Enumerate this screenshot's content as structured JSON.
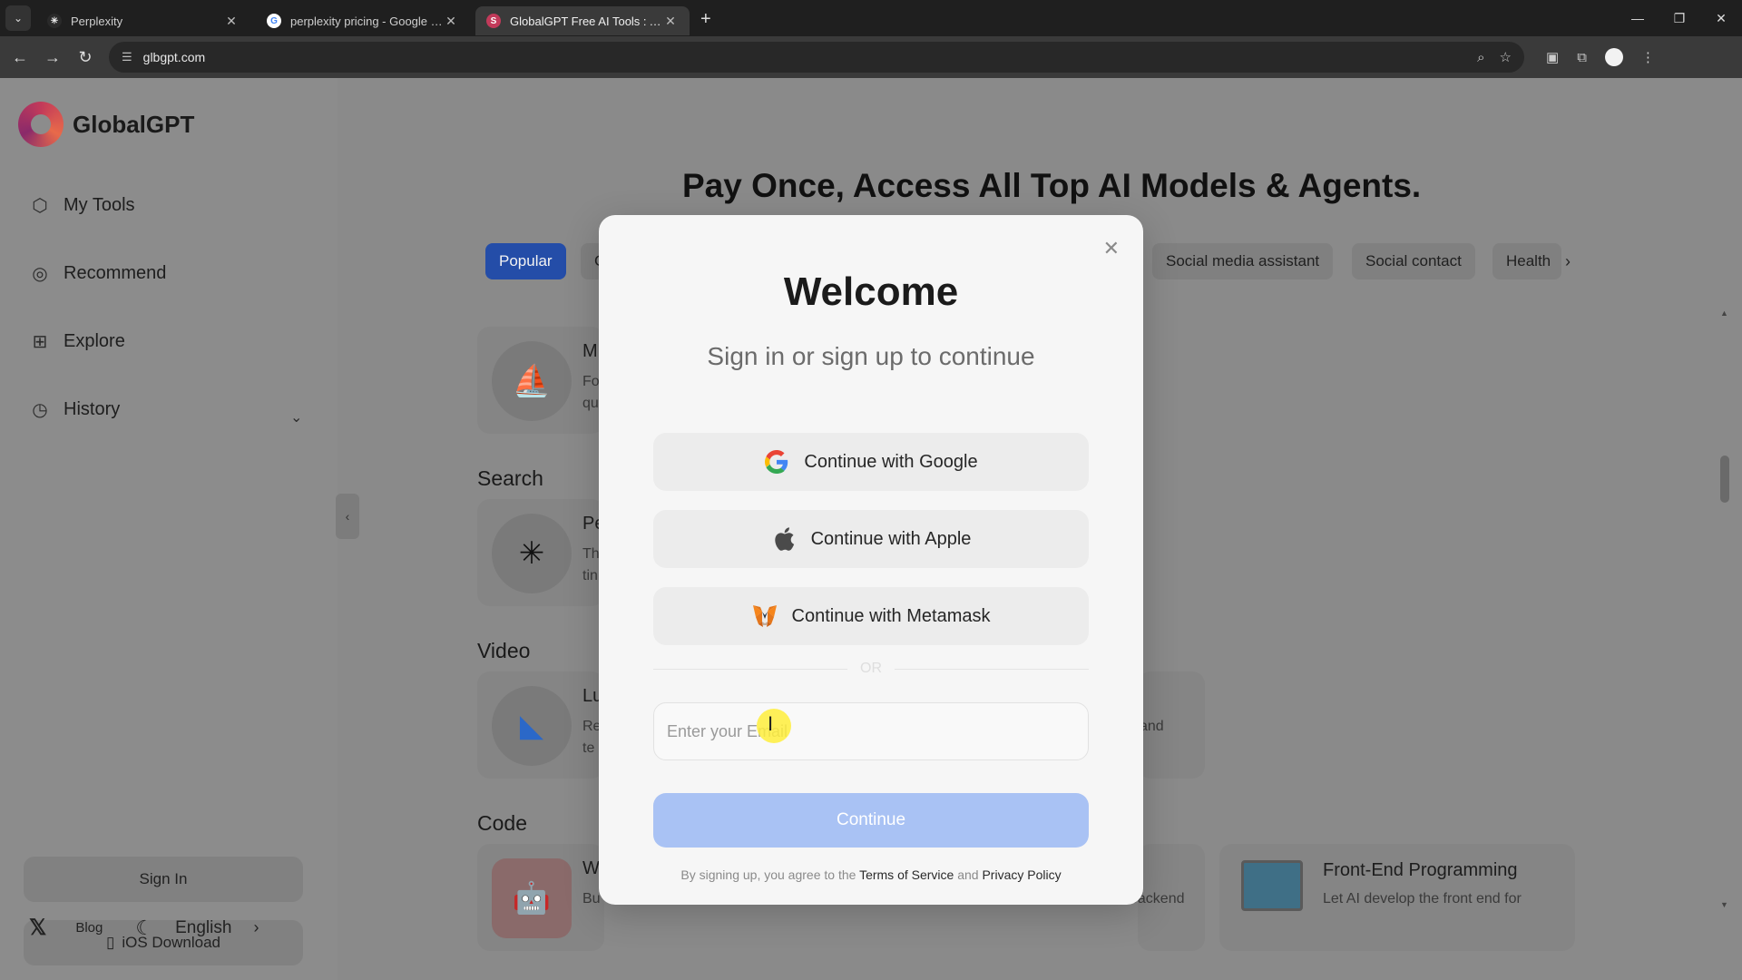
{
  "browser": {
    "tabs": [
      {
        "title": "Perplexity",
        "active": false
      },
      {
        "title": "perplexity pricing - Google Sea",
        "active": false
      },
      {
        "title": "GlobalGPT Free AI Tools : All-in",
        "active": true
      }
    ],
    "url": "glbgpt.com"
  },
  "sidebar": {
    "brand": "GlobalGPT",
    "items": [
      {
        "label": "My Tools",
        "icon": "cube-icon"
      },
      {
        "label": "Recommend",
        "icon": "compass-icon"
      },
      {
        "label": "Explore",
        "icon": "grid-icon"
      },
      {
        "label": "History",
        "icon": "clock-icon"
      }
    ],
    "sign_in": "Sign In",
    "ios_download": "iOS Download",
    "blog": "Blog",
    "language": "English"
  },
  "main": {
    "title": "Pay Once, Access All Top AI Models & Agents.",
    "chips": [
      "Popular",
      "C",
      "Social media assistant",
      "Social contact",
      "Health"
    ],
    "sections": {
      "search": "Search",
      "video": "Video",
      "code": "Code"
    },
    "cards": {
      "top_title": "M",
      "top_desc1": "Fo",
      "top_desc2": "qu",
      "search_title": "Pe",
      "search_desc1": "Th",
      "search_desc2": "tin",
      "video_title": "Lu",
      "video_desc1": "Re",
      "video_desc2": "te",
      "video_right_desc": "and",
      "code_title": "W",
      "code_desc": "Bu",
      "code_mid_desc": "backend",
      "frontend_title": "Front-End Programming",
      "frontend_desc": "Let AI develop the front end for"
    }
  },
  "modal": {
    "title": "Welcome",
    "subtitle": "Sign in or sign up to continue",
    "google": "Continue with Google",
    "apple": "Continue with Apple",
    "metamask": "Continue with Metamask",
    "or": "OR",
    "email_placeholder": "Enter your Email",
    "continue": "Continue",
    "terms_prefix": "By signing up, you agree to the",
    "terms_link": "Terms of Service",
    "terms_and": "and",
    "privacy_link": "Privacy Policy"
  }
}
